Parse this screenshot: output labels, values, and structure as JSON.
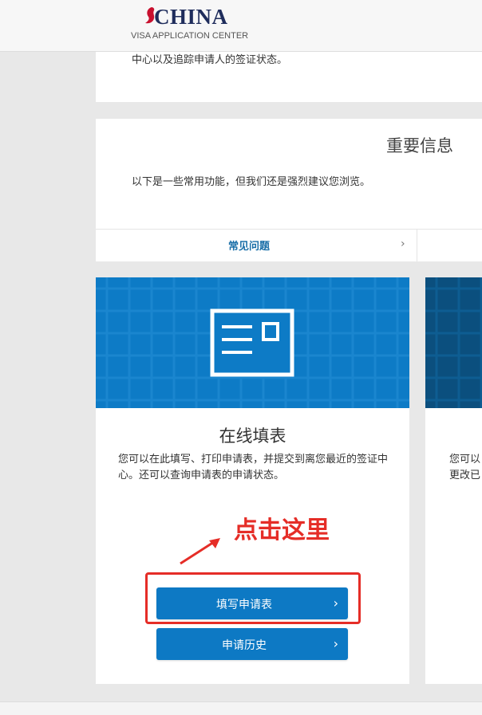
{
  "header": {
    "logo_word": "CHINA",
    "logo_word_rest": "HINA",
    "logo_initial": "C",
    "logo_subtitle": "VISA APPLICATION CENTER"
  },
  "card1": {
    "text": "中心以及追踪申请人的签证状态。"
  },
  "card2": {
    "title": "重要信息",
    "description": "以下是一些常用功能，但我们还是强烈建议您浏览。",
    "faq_label": "常见问题"
  },
  "tile_online_form": {
    "title": "在线填表",
    "description": "您可以在此填写、打印申请表，并提交到离您最近的签证中心。还可以查询申请表的申请状态。",
    "fill_button": "填写申请表",
    "history_button": "申请历史"
  },
  "tile_partial": {
    "description_line1": "您可以",
    "description_line2": "更改已"
  },
  "annotation": {
    "text": "点击这里"
  },
  "colors": {
    "primary_blue": "#0d79c4",
    "hero_blue": "#0d7bc6",
    "dark_hero_blue": "#0b4f7e",
    "annotation_red": "#e52d27",
    "logo_navy": "#1f2d5c"
  }
}
